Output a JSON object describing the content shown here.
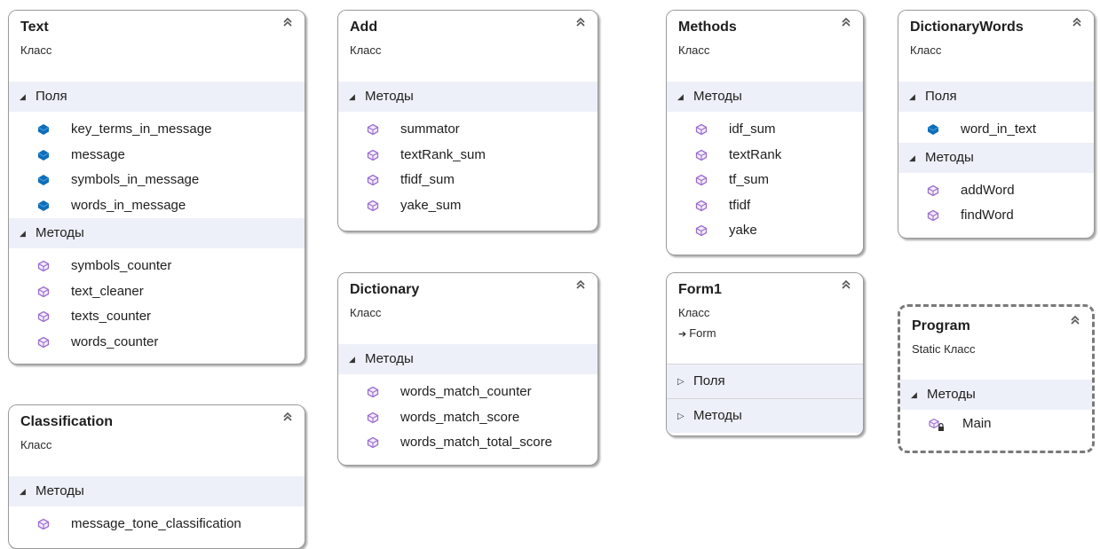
{
  "colors": {
    "field_icon": "#0e6eb8",
    "method_icon": "#9b6fcf",
    "section_bg": "#edf0f8",
    "border": "#9a9a9a"
  },
  "classes": [
    {
      "name": "Text",
      "stereotype": "Класс",
      "sections": [
        {
          "label": "Поля",
          "kind": "fields",
          "items": [
            "key_terms_in_message",
            "message",
            "symbols_in_message",
            "words_in_message"
          ]
        },
        {
          "label": "Методы",
          "kind": "methods",
          "items": [
            "symbols_counter",
            "text_cleaner",
            "texts_counter",
            "words_counter"
          ]
        }
      ]
    },
    {
      "name": "Classification",
      "stereotype": "Класс",
      "sections": [
        {
          "label": "Методы",
          "kind": "methods",
          "items": [
            "message_tone_classification"
          ]
        }
      ]
    },
    {
      "name": "Add",
      "stereotype": "Класс",
      "sections": [
        {
          "label": "Методы",
          "kind": "methods",
          "items": [
            "summator",
            "textRank_sum",
            "tfidf_sum",
            "yake_sum"
          ]
        }
      ]
    },
    {
      "name": "Dictionary",
      "stereotype": "Класс",
      "sections": [
        {
          "label": "Методы",
          "kind": "methods",
          "items": [
            "words_match_counter",
            "words_match_score",
            "words_match_total_score"
          ]
        }
      ]
    },
    {
      "name": "Methods",
      "stereotype": "Класс",
      "sections": [
        {
          "label": "Методы",
          "kind": "methods",
          "items": [
            "idf_sum",
            "textRank",
            "tf_sum",
            "tfidf",
            "yake"
          ]
        }
      ]
    },
    {
      "name": "Form1",
      "stereotype": "Класс",
      "base": "Form",
      "sections": [
        {
          "label": "Поля",
          "kind": "collapsed",
          "items": []
        },
        {
          "label": "Методы",
          "kind": "collapsed",
          "items": []
        }
      ]
    },
    {
      "name": "DictionaryWords",
      "stereotype": "Класс",
      "sections": [
        {
          "label": "Поля",
          "kind": "fields",
          "items": [
            "word_in_text"
          ]
        },
        {
          "label": "Методы",
          "kind": "methods",
          "items": [
            "addWord",
            "findWord"
          ]
        }
      ]
    },
    {
      "name": "Program",
      "stereotype": "Static Класс",
      "sections": [
        {
          "label": "Методы",
          "kind": "private-methods",
          "items": [
            "Main"
          ]
        }
      ]
    }
  ]
}
